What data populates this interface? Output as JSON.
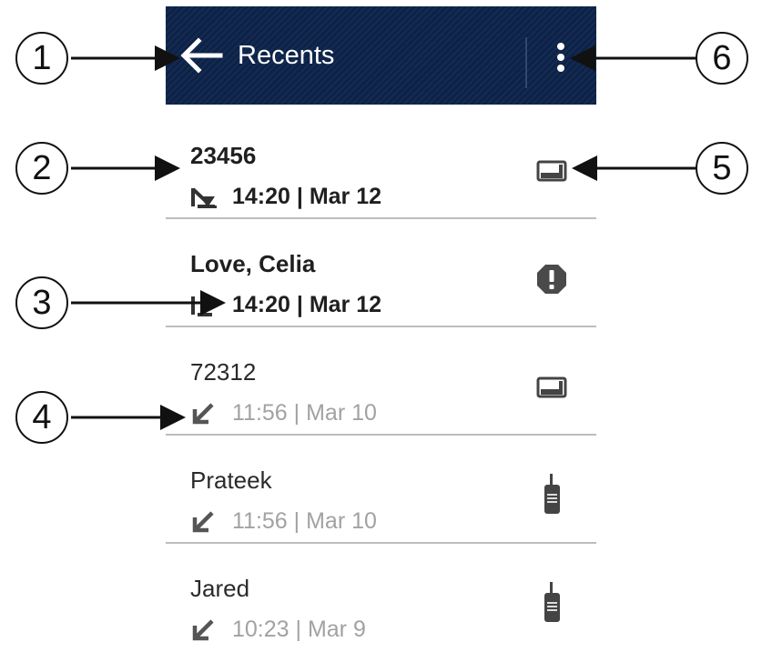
{
  "appbar": {
    "title": "Recents",
    "back_icon": "arrow-left-icon",
    "menu_icon": "overflow-menu-icon",
    "background": "#0c2248"
  },
  "recents": [
    {
      "name": "23456",
      "time": "14:20 | Mar 12",
      "direction_icon": "missed-call-icon",
      "type_icon": "radio-dispatch-console-icon",
      "unread": true
    },
    {
      "name": "Love, Celia",
      "time": "14:20 | Mar 12",
      "direction_icon": "outgoing-call-icon",
      "type_icon": "emergency-alert-icon",
      "unread": true
    },
    {
      "name": "72312",
      "time": "11:56 | Mar 10",
      "direction_icon": "incoming-call-icon",
      "type_icon": "radio-dispatch-console-icon",
      "unread": false
    },
    {
      "name": "Prateek",
      "time": "11:56 | Mar 10",
      "direction_icon": "incoming-call-icon",
      "type_icon": "portable-radio-icon",
      "unread": false
    },
    {
      "name": "Jared",
      "time": "10:23 | Mar 9",
      "direction_icon": "incoming-call-icon",
      "type_icon": "portable-radio-icon",
      "unread": false
    }
  ],
  "callouts": [
    "1",
    "2",
    "3",
    "4",
    "5",
    "6"
  ]
}
